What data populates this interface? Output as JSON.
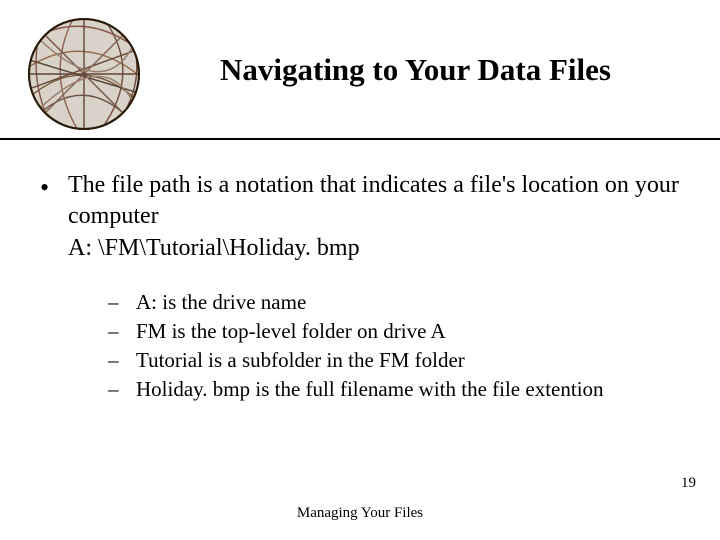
{
  "slide": {
    "title": "Navigating to Your Data Files",
    "bullet_main": "The file path is a notation that indicates a file's location on your computer",
    "path_example": "A: \\FM\\Tutorial\\Holiday. bmp",
    "sub_items": [
      "A: is the drive name",
      "FM is the top-level folder on drive A",
      "Tutorial is a subfolder in the FM folder",
      "Holiday. bmp is the full filename with the file extention"
    ],
    "footer": "Managing Your Files",
    "page_number": "19"
  },
  "logo": {
    "name": "abstract-sphere-logo"
  }
}
